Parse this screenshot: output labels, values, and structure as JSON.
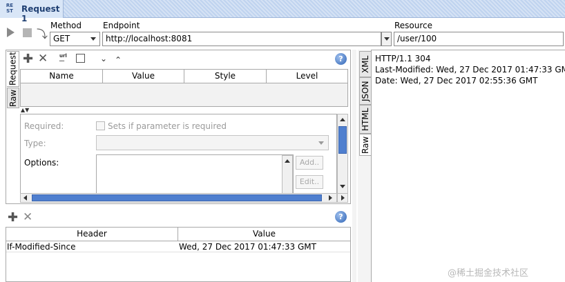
{
  "window": {
    "title": "Request 1",
    "rest_icon_top": "RE",
    "rest_icon_bottom": "ST"
  },
  "toolbar": {
    "method_label": "Method",
    "method_value": "GET",
    "endpoint_label": "Endpoint",
    "endpoint_value": "http://localhost:8081",
    "resource_label": "Resource",
    "resource_value": "/user/100"
  },
  "request_tabs": [
    "Request",
    "Raw"
  ],
  "params_table": {
    "columns": [
      "Name",
      "Value",
      "Style",
      "Level"
    ]
  },
  "param_form": {
    "required_label": "Required:",
    "required_checkbox_text": "Sets if parameter is required",
    "type_label": "Type:",
    "options_label": "Options:",
    "add_button": "Add..",
    "edit_button": "Edit.."
  },
  "headers_table": {
    "columns": [
      "Header",
      "Value"
    ],
    "rows": [
      {
        "header": "If-Modified-Since",
        "value": "Wed, 27 Dec 2017 01:47:33 GMT"
      }
    ]
  },
  "response_tabs": [
    "XML",
    "JSON",
    "HTML",
    "Raw"
  ],
  "response": {
    "lines": [
      "HTTP/1.1 304",
      "Last-Modified: Wed, 27 Dec 2017 01:47:33 GMT",
      "Date: Wed, 27 Dec 2017 02:55:36 GMT"
    ]
  },
  "help_symbol": "?",
  "watermark": "@稀土掘金技术社区",
  "colors": {
    "accent": "#2d62b4",
    "scroll_thumb": "#4f7fcf",
    "title_bar": "#bfd3ef"
  }
}
